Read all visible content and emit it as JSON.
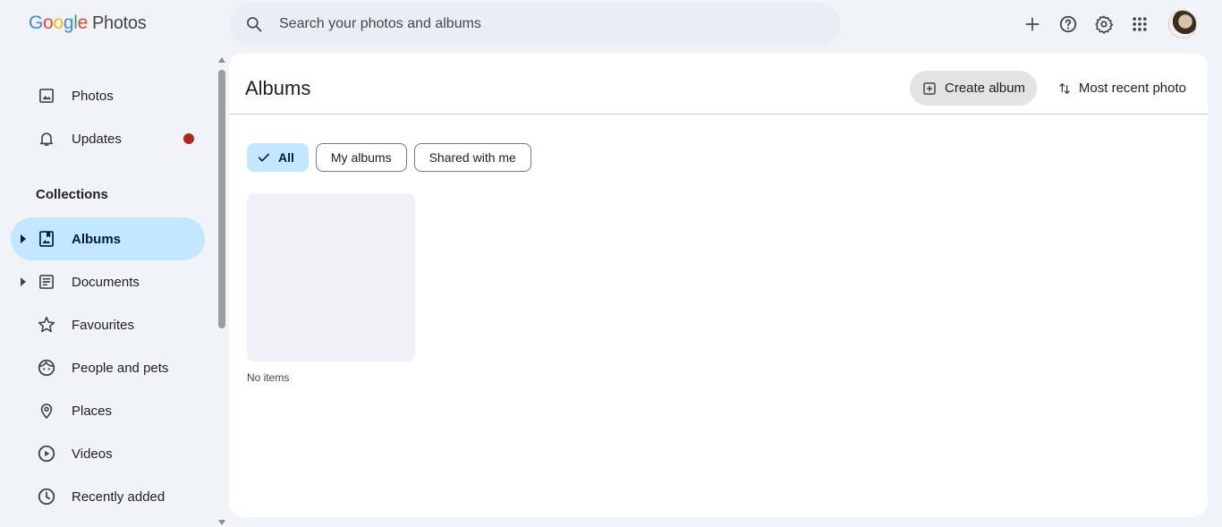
{
  "app": {
    "logo_google": "Google",
    "logo_product": "Photos",
    "search_placeholder": "Search your photos and albums"
  },
  "top_icons": [
    "plus-icon",
    "help-icon",
    "gear-icon",
    "apps-grid-icon"
  ],
  "sidebar": {
    "items_top": [
      {
        "label": "Photos",
        "icon": "image-icon"
      },
      {
        "label": "Updates",
        "icon": "bell-icon",
        "has_notification_dot": true
      }
    ],
    "section_title": "Collections",
    "collections": [
      {
        "label": "Albums",
        "icon": "album-icon",
        "expandable": true,
        "active": true
      },
      {
        "label": "Documents",
        "icon": "document-icon",
        "expandable": true,
        "active": false
      },
      {
        "label": "Favourites",
        "icon": "star-icon",
        "expandable": false,
        "active": false
      },
      {
        "label": "People and pets",
        "icon": "face-icon",
        "expandable": false,
        "active": false
      },
      {
        "label": "Places",
        "icon": "location-pin-icon",
        "expandable": false,
        "active": false
      },
      {
        "label": "Videos",
        "icon": "play-circle-icon",
        "expandable": false,
        "active": false
      },
      {
        "label": "Recently added",
        "icon": "clock-icon",
        "expandable": false,
        "active": false
      }
    ]
  },
  "main": {
    "title": "Albums",
    "create_album_label": "Create album",
    "sort_label": "Most recent photo",
    "filters": [
      {
        "label": "All",
        "selected": true
      },
      {
        "label": "My albums",
        "selected": false
      },
      {
        "label": "Shared with me",
        "selected": false
      }
    ],
    "albums": [
      {
        "label": "No items"
      }
    ]
  },
  "colors": {
    "background": "#f0f4f9",
    "active_nav": "#c2e7ff",
    "notification_dot": "#b3261e",
    "search_bg": "#e9eef6"
  }
}
